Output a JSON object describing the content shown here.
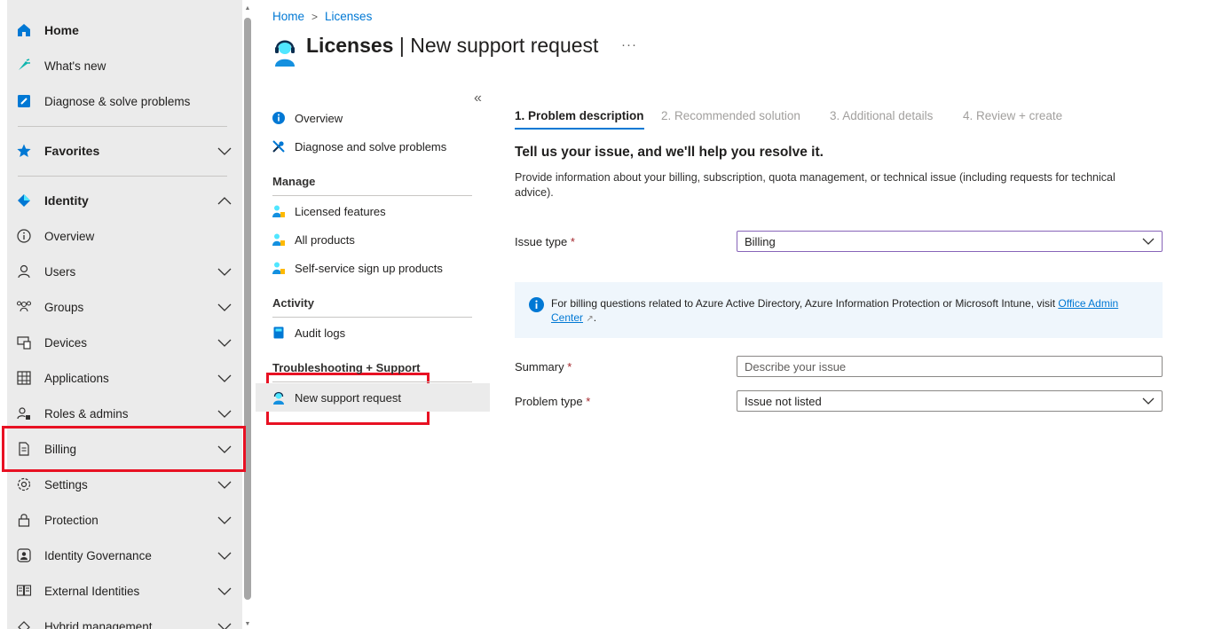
{
  "left_nav": {
    "items": [
      {
        "label": "Home",
        "icon": "home-icon",
        "bold": true
      },
      {
        "label": "What's new",
        "icon": "whats-new-icon"
      },
      {
        "label": "Diagnose & solve problems",
        "icon": "diagnose-icon"
      },
      {
        "label": "Favorites",
        "icon": "star-icon",
        "bold": true,
        "expandable": "collapsed"
      },
      {
        "label": "Identity",
        "icon": "identity-icon",
        "bold": true,
        "expandable": "expanded"
      },
      {
        "label": "Overview",
        "icon": "info-icon"
      },
      {
        "label": "Users",
        "icon": "user-icon",
        "expandable": "collapsed"
      },
      {
        "label": "Groups",
        "icon": "groups-icon",
        "expandable": "collapsed"
      },
      {
        "label": "Devices",
        "icon": "devices-icon",
        "expandable": "collapsed"
      },
      {
        "label": "Applications",
        "icon": "applications-icon",
        "expandable": "collapsed"
      },
      {
        "label": "Roles & admins",
        "icon": "roles-icon",
        "expandable": "collapsed"
      },
      {
        "label": "Billing",
        "icon": "billing-icon",
        "expandable": "collapsed"
      },
      {
        "label": "Settings",
        "icon": "settings-icon",
        "expandable": "collapsed"
      },
      {
        "label": "Protection",
        "icon": "lock-icon",
        "expandable": "collapsed"
      },
      {
        "label": "Identity Governance",
        "icon": "governance-icon",
        "expandable": "collapsed"
      },
      {
        "label": "External Identities",
        "icon": "external-identities-icon",
        "expandable": "collapsed"
      },
      {
        "label": "Hybrid management",
        "icon": "hybrid-icon",
        "expandable": "collapsed"
      }
    ]
  },
  "breadcrumb": {
    "home": "Home",
    "current": "Licenses"
  },
  "page": {
    "title_bold": "Licenses",
    "title_rest": "| New support request",
    "more": "···"
  },
  "resource_menu": {
    "collapse": "«",
    "top_items": [
      {
        "label": "Overview",
        "icon": "info-circle-icon"
      },
      {
        "label": "Diagnose and solve problems",
        "icon": "wrench-icon"
      }
    ],
    "manage_header": "Manage",
    "manage_items": [
      {
        "label": "Licensed features",
        "icon": "license-icon"
      },
      {
        "label": "All products",
        "icon": "license-icon"
      },
      {
        "label": "Self-service sign up products",
        "icon": "license-icon"
      }
    ],
    "activity_header": "Activity",
    "activity_items": [
      {
        "label": "Audit logs",
        "icon": "book-icon"
      }
    ],
    "troubleshoot_header": "Troubleshooting + Support",
    "troubleshoot_items": [
      {
        "label": "New support request",
        "icon": "support-agent-icon",
        "active": true
      }
    ]
  },
  "wizard": {
    "steps": [
      "1. Problem description",
      "2. Recommended solution",
      "3. Additional details",
      "4. Review + create"
    ],
    "active_step": 0
  },
  "form": {
    "heading": "Tell us your issue, and we'll help you resolve it.",
    "description": "Provide information about your billing, subscription, quota management, or technical issue (including requests for technical advice).",
    "issue_type_label": "Issue type",
    "issue_type_value": "Billing",
    "info_text": "For billing questions related to Azure Active Directory, Azure Information Protection or Microsoft Intune, visit",
    "info_link": "Office Admin Center",
    "info_end": ".",
    "summary_label": "Summary",
    "summary_placeholder": "Describe your issue",
    "problem_type_label": "Problem type",
    "problem_type_value": "Issue not listed",
    "required_mark": "*"
  },
  "colors": {
    "accent": "#0078d4",
    "highlight": "#e81123",
    "info_bg": "#eff6fc"
  }
}
